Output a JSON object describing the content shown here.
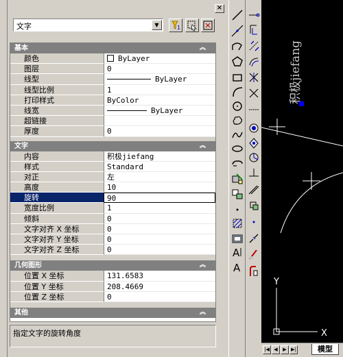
{
  "palette": {
    "selection_value": "文字",
    "sections": {
      "general": {
        "title": "基本",
        "rows": [
          {
            "label": "颜色",
            "value": "ByLayer"
          },
          {
            "label": "图层",
            "value": "0"
          },
          {
            "label": "线型",
            "value": "ByLayer"
          },
          {
            "label": "线型比例",
            "value": "1"
          },
          {
            "label": "打印样式",
            "value": "ByColor"
          },
          {
            "label": "线宽",
            "value": "ByLayer"
          },
          {
            "label": "超链接",
            "value": ""
          },
          {
            "label": "厚度",
            "value": "0"
          }
        ]
      },
      "text": {
        "title": "文字",
        "rows": [
          {
            "label": "内容",
            "value": "积极jiefang"
          },
          {
            "label": "样式",
            "value": "Standard"
          },
          {
            "label": "对正",
            "value": "左"
          },
          {
            "label": "高度",
            "value": "10"
          },
          {
            "label": "旋转",
            "value": "90"
          },
          {
            "label": "宽度比例",
            "value": "1"
          },
          {
            "label": "倾斜",
            "value": "0"
          },
          {
            "label": "文字对齐 X 坐标",
            "value": "0"
          },
          {
            "label": "文字对齐 Y 坐标",
            "value": "0"
          },
          {
            "label": "文字对齐 Z 坐标",
            "value": "0"
          }
        ]
      },
      "geometry": {
        "title": "几何图形",
        "rows": [
          {
            "label": "位置 X 坐标",
            "value": "131.6583"
          },
          {
            "label": "位置 Y 坐标",
            "value": "208.4669"
          },
          {
            "label": "位置 Z 坐标",
            "value": "0"
          }
        ]
      },
      "misc": {
        "title": "其他"
      }
    },
    "description": "指定文字的旋转角度"
  },
  "canvas": {
    "text_object": "积极jiefang",
    "ucs_x": "X",
    "ucs_y": "Y",
    "grip_color": "#0000ff"
  },
  "tabs": {
    "model": "模型"
  },
  "icons": {
    "draw_toolbar": [
      "line-icon",
      "construction-line-icon",
      "polyline-icon",
      "polygon-icon",
      "rectangle-icon",
      "arc-icon",
      "circle-icon",
      "revision-cloud-icon",
      "spline-icon",
      "ellipse-icon",
      "ellipse-arc-icon",
      "insert-block-icon",
      "make-block-icon",
      "point-icon",
      "hatch-icon",
      "region-icon",
      "multiline-text-icon",
      "single-line-text-icon"
    ],
    "modify_toolbar": [
      "erase-icon",
      "copy-icon",
      "mirror-icon",
      "offset-icon",
      "array-icon",
      "move-icon",
      "rotate-icon",
      "scale-icon",
      "stretch-icon",
      "trim-icon",
      "extend-icon",
      "break-at-point-icon",
      "break-icon",
      "join-icon",
      "chamfer-icon",
      "fillet-icon",
      "explode-icon"
    ]
  }
}
